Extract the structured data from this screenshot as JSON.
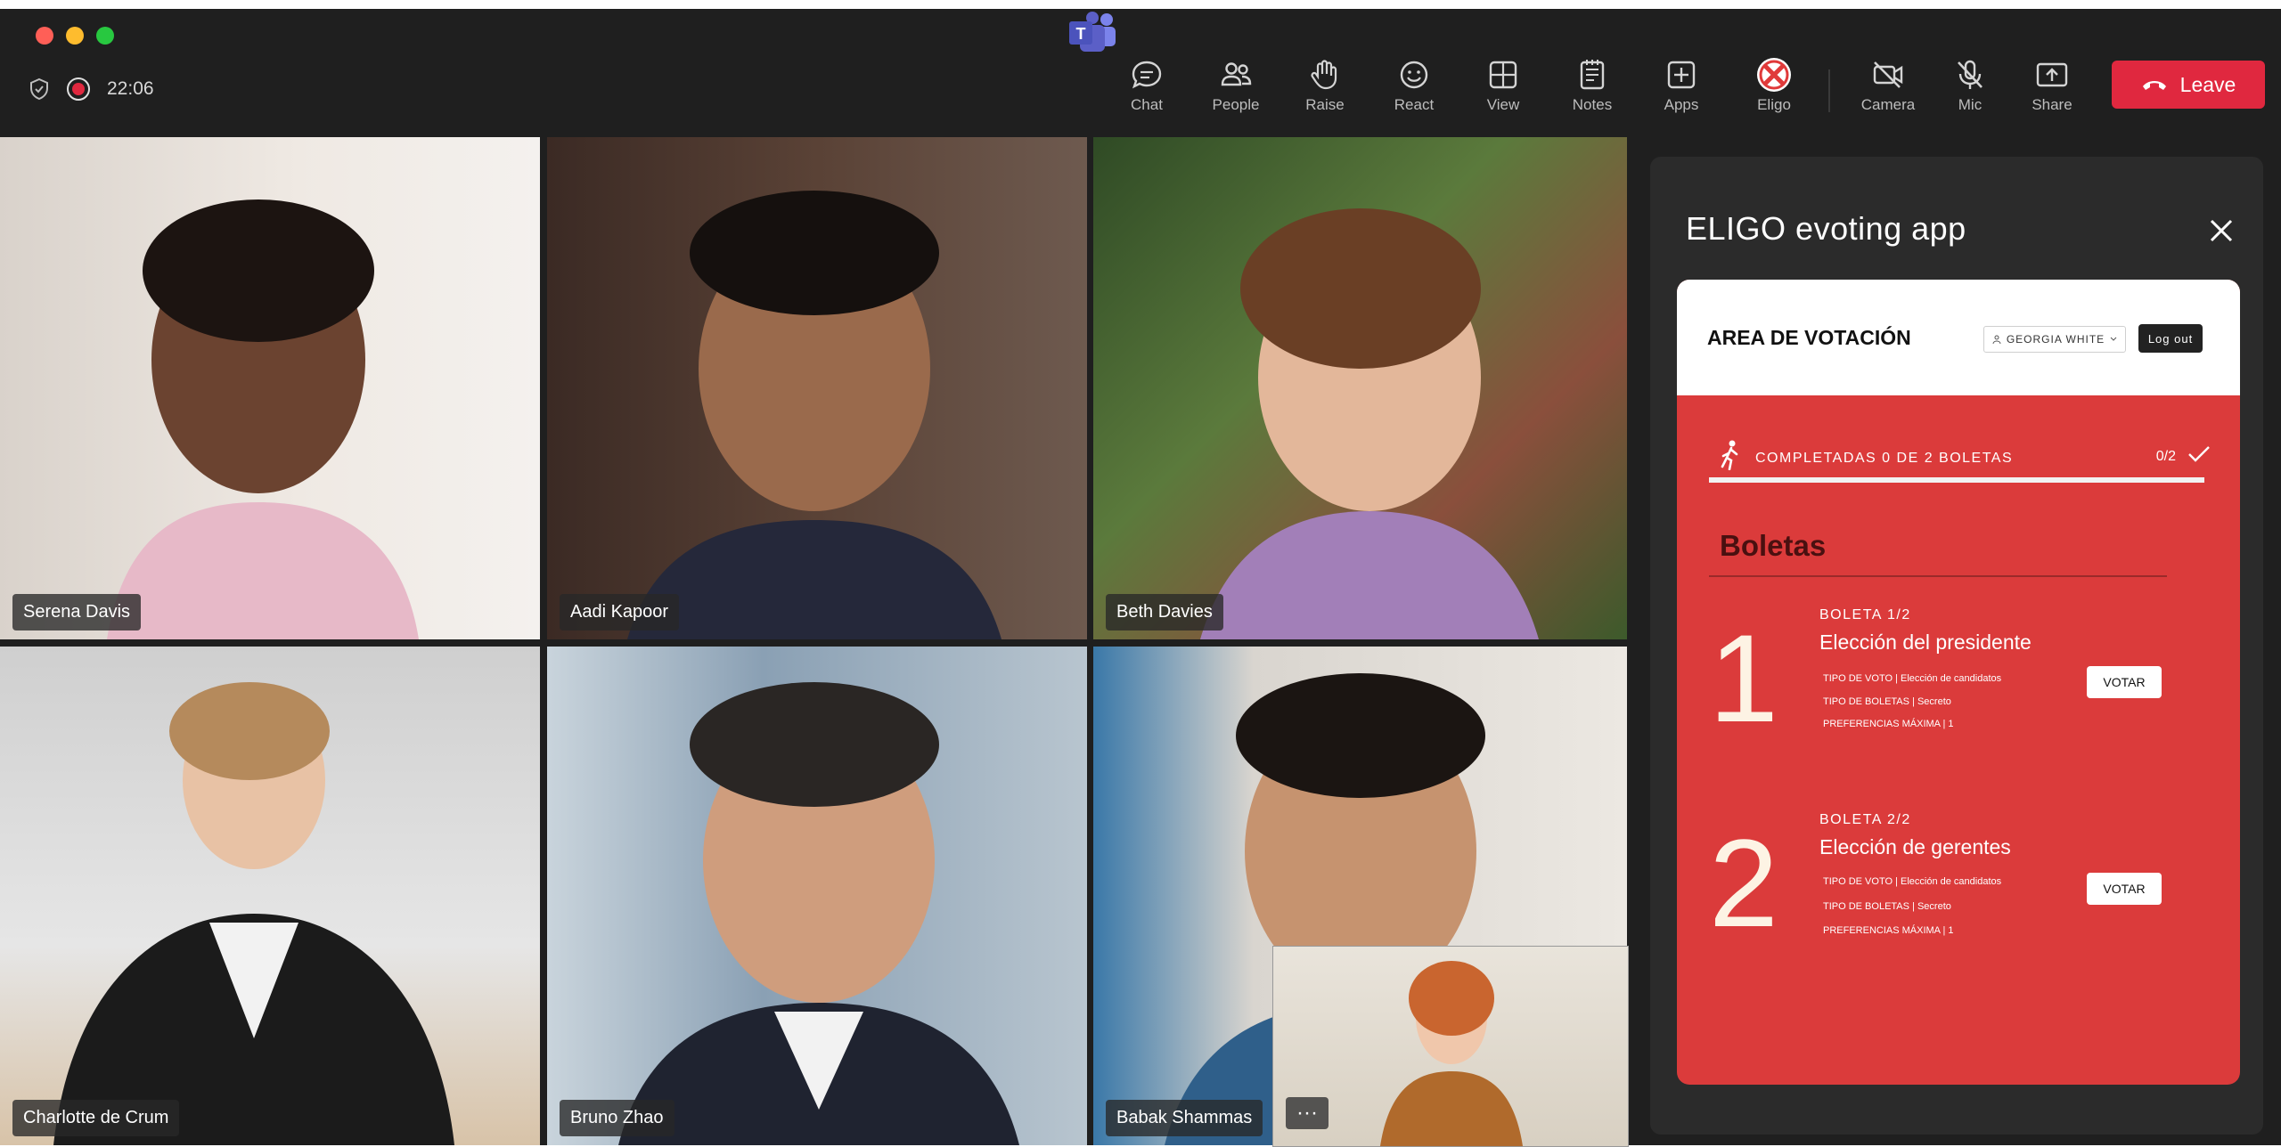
{
  "meeting": {
    "timer": "22:06"
  },
  "toolbar": [
    {
      "label": "Chat",
      "icon": "chat-icon"
    },
    {
      "label": "People",
      "icon": "people-icon"
    },
    {
      "label": "Raise",
      "icon": "raise-hand-icon"
    },
    {
      "label": "React",
      "icon": "react-icon"
    },
    {
      "label": "View",
      "icon": "view-grid-icon"
    },
    {
      "label": "Notes",
      "icon": "notes-icon"
    },
    {
      "label": "Apps",
      "icon": "apps-icon"
    },
    {
      "label": "Eligo",
      "icon": "eligo-icon"
    },
    {
      "label": "Camera",
      "icon": "camera-off-icon"
    },
    {
      "label": "Mic",
      "icon": "mic-off-icon"
    },
    {
      "label": "Share",
      "icon": "share-icon"
    }
  ],
  "leave": {
    "label": "Leave"
  },
  "participants": [
    {
      "name": "Serena Davis"
    },
    {
      "name": "Aadi Kapoor"
    },
    {
      "name": "Beth Davies"
    },
    {
      "name": "Charlotte de Crum"
    },
    {
      "name": "Bruno Zhao"
    },
    {
      "name": "Babak Shammas"
    }
  ],
  "more": {
    "label": "···"
  },
  "panel": {
    "title": "ELIGO evoting app",
    "area_title": "AREA DE VOTACIÓN",
    "user": "GEORGIA WHITE",
    "logout": "Log out",
    "progress_label": "COMPLETADAS 0 DE 2 BOLETAS",
    "progress_count": "0/2",
    "progress_fraction": 0,
    "boletas_title": "Boletas",
    "ballots": [
      {
        "number": "1",
        "kicker": "BOLETA 1/2",
        "title": "Elección del presidente",
        "meta": [
          "TIPO DE VOTO | Elección de candidatos",
          "TIPO DE BOLETAS | Secreto",
          "PREFERENCIAS MÁXIMA | 1"
        ],
        "button": "VOTAR"
      },
      {
        "number": "2",
        "kicker": "BOLETA 2/2",
        "title": "Elección de gerentes",
        "meta": [
          "TIPO DE VOTO | Elección de candidatos",
          "TIPO DE BOLETAS | Secreto",
          "PREFERENCIAS MÁXIMA | 1"
        ],
        "button": "VOTAR"
      }
    ]
  },
  "colors": {
    "leave": "#e0283f",
    "eligo_red": "#db3b3b",
    "toolbar_bg": "#1f1f1f"
  }
}
